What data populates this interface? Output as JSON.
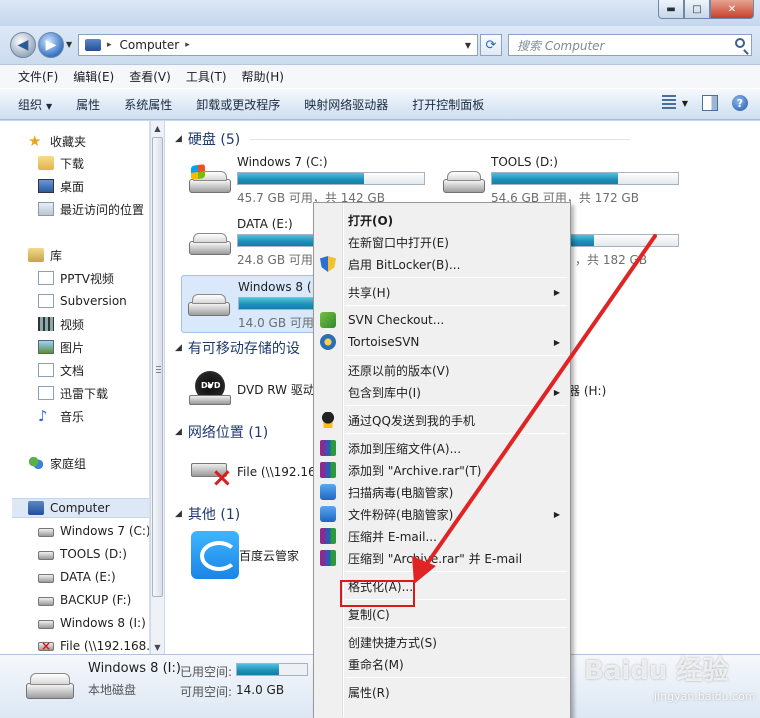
{
  "window": {
    "minimize": "▬",
    "maximize": "□",
    "close": "✕"
  },
  "address": {
    "crumb": "Computer",
    "separator": "▸",
    "search_placeholder": "搜索 Computer"
  },
  "menu": [
    "文件(F)",
    "编辑(E)",
    "查看(V)",
    "工具(T)",
    "帮助(H)"
  ],
  "toolbar": {
    "organize": "组织",
    "items": [
      "属性",
      "系统属性",
      "卸载或更改程序",
      "映射网络驱动器",
      "打开控制面板"
    ],
    "help": "?"
  },
  "nav": {
    "favorites": "收藏夹",
    "fav_items": [
      "下载",
      "桌面",
      "最近访问的位置"
    ],
    "library": "库",
    "lib_items": [
      "PPTV视频",
      "Subversion",
      "视频",
      "图片",
      "文档",
      "迅雷下载",
      "音乐"
    ],
    "homegroup": "家庭组",
    "computer": "Computer",
    "computer_items": [
      "Windows 7 (C:)",
      "TOOLS (D:)",
      "DATA (E:)",
      "BACKUP (F:)",
      "Windows 8 (I:)",
      "File (\\\\192.168.7"
    ]
  },
  "groups": {
    "hdd": "硬盘 (5)",
    "removable": "有可移动存储的设",
    "network": "网络位置 (1)",
    "other": "其他 (1)"
  },
  "drives": [
    {
      "name": "Windows 7 (C:)",
      "info": "45.7 GB 可用，共 142 GB",
      "used": 0.68
    },
    {
      "name": "TOOLS (D:)",
      "info": "54.6 GB 可用，共 172 GB",
      "used": 0.68
    },
    {
      "name": "DATA (E:)",
      "info": "24.8 GB 可用",
      "used": 0.86
    },
    {
      "name": "",
      "info": "，共 182 GB",
      "used": 0.55
    },
    {
      "name": "Windows 8 (",
      "info": "14.0 GB 可用",
      "used": 0.6
    }
  ],
  "removable": {
    "dvd": "DVD RW 驱动",
    "dvd_label": "DVD",
    "other": "器 (H:)"
  },
  "network": {
    "file": "File (\\\\192.16"
  },
  "other": {
    "baidu": "百度云管家"
  },
  "context_menu": [
    {
      "label": "打开(O)",
      "bold": true
    },
    {
      "label": "在新窗口中打开(E)"
    },
    {
      "label": "启用 BitLocker(B)...",
      "icon": "shield-icon"
    },
    {
      "sep": true
    },
    {
      "label": "共享(H)",
      "sub": true
    },
    {
      "sep": true
    },
    {
      "label": "SVN Checkout...",
      "icon": "svn-checkout-icon"
    },
    {
      "label": "TortoiseSVN",
      "icon": "tortoisesvn-icon",
      "sub": true
    },
    {
      "sep": true
    },
    {
      "label": "还原以前的版本(V)"
    },
    {
      "label": "包含到库中(I)",
      "sub": true
    },
    {
      "sep": true
    },
    {
      "label": "通过QQ发送到我的手机",
      "icon": "qq-icon"
    },
    {
      "sep": true
    },
    {
      "label": "添加到压缩文件(A)...",
      "icon": "winrar-icon"
    },
    {
      "label": "添加到 \"Archive.rar\"(T)",
      "icon": "winrar-icon"
    },
    {
      "label": "扫描病毒(电脑管家)",
      "icon": "tencent-icon"
    },
    {
      "label": "文件粉碎(电脑管家)",
      "icon": "tencent-icon",
      "sub": true
    },
    {
      "label": "压缩并 E-mail...",
      "icon": "winrar-icon"
    },
    {
      "label": "压缩到 \"Archive.rar\" 并 E-mail",
      "icon": "winrar-icon"
    },
    {
      "sep": true
    },
    {
      "label": "格式化(A)..."
    },
    {
      "sep": true
    },
    {
      "label": "复制(C)"
    },
    {
      "sep": true
    },
    {
      "label": "创建快捷方式(S)"
    },
    {
      "label": "重命名(M)"
    },
    {
      "sep": true
    },
    {
      "label": "属性(R)"
    }
  ],
  "details": {
    "name": "Windows 8 (I:)",
    "type": "本地磁盘",
    "used_label": "已用空间:",
    "free_label": "可用空间:",
    "free_value": "14.0 GB",
    "used": 0.6
  },
  "watermark": {
    "brand": "Baidu 经验",
    "url": "jingyan.baidu.com"
  },
  "colors": {
    "accent": "#1c8fb8",
    "highlight": "#d91a1a"
  }
}
